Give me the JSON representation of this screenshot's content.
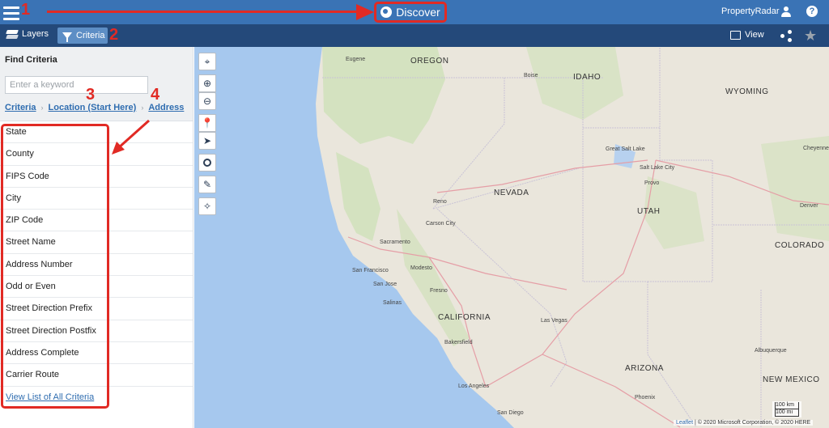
{
  "topbar": {
    "discover_label": "Discover",
    "brand": "PropertyRadar",
    "bg_color": "#3a73b5"
  },
  "subbar": {
    "layers_label": "Layers",
    "criteria_label": "Criteria",
    "view_label": "View",
    "bg_color": "#24497a"
  },
  "sidebar": {
    "title": "Find Criteria",
    "search_placeholder": "Enter a keyword",
    "breadcrumbs": [
      "Criteria",
      "Location (Start Here)",
      "Address"
    ],
    "items": [
      "State",
      "County",
      "FIPS Code",
      "City",
      "ZIP Code",
      "Street Name",
      "Address Number",
      "Odd or Even",
      "Street Direction Prefix",
      "Street Direction Postfix",
      "Address Complete",
      "Carrier Route"
    ],
    "view_all_label": "View List of All Criteria"
  },
  "map": {
    "labels": {
      "oregon": "OREGON",
      "idaho": "IDAHO",
      "wyoming": "WYOMING",
      "nevada": "NEVADA",
      "utah": "UTAH",
      "colorado": "COLORADO",
      "california": "CALIFORNIA",
      "arizona": "ARIZONA",
      "new_mexico": "NEW MEXICO",
      "eugene": "Eugene",
      "boise": "Boise",
      "great_salt_lake": "Great Salt Lake",
      "salt_lake_city": "Salt Lake City",
      "cheyenne": "Cheyenne",
      "denver": "Denver",
      "provo": "Provo",
      "reno": "Reno",
      "carson_city": "Carson City",
      "sacramento": "Sacramento",
      "san_francisco": "San Francisco",
      "modesto": "Modesto",
      "san_jose": "San Jose",
      "fresno": "Fresno",
      "salinas": "Salinas",
      "bakersfield": "Bakersfield",
      "las_vegas": "Las Vegas",
      "los_angeles": "Los Angeles",
      "san_diego": "San Diego",
      "phoenix": "Phoenix",
      "albuquerque": "Albuquerque"
    },
    "scale_km": "100 km",
    "scale_mi": "100 mi",
    "attribution_link": "Leaflet",
    "attribution_text": " | © 2020 Microsoft Corporation, © 2020 HERE"
  },
  "annotations": [
    "1",
    "2",
    "3",
    "4"
  ]
}
